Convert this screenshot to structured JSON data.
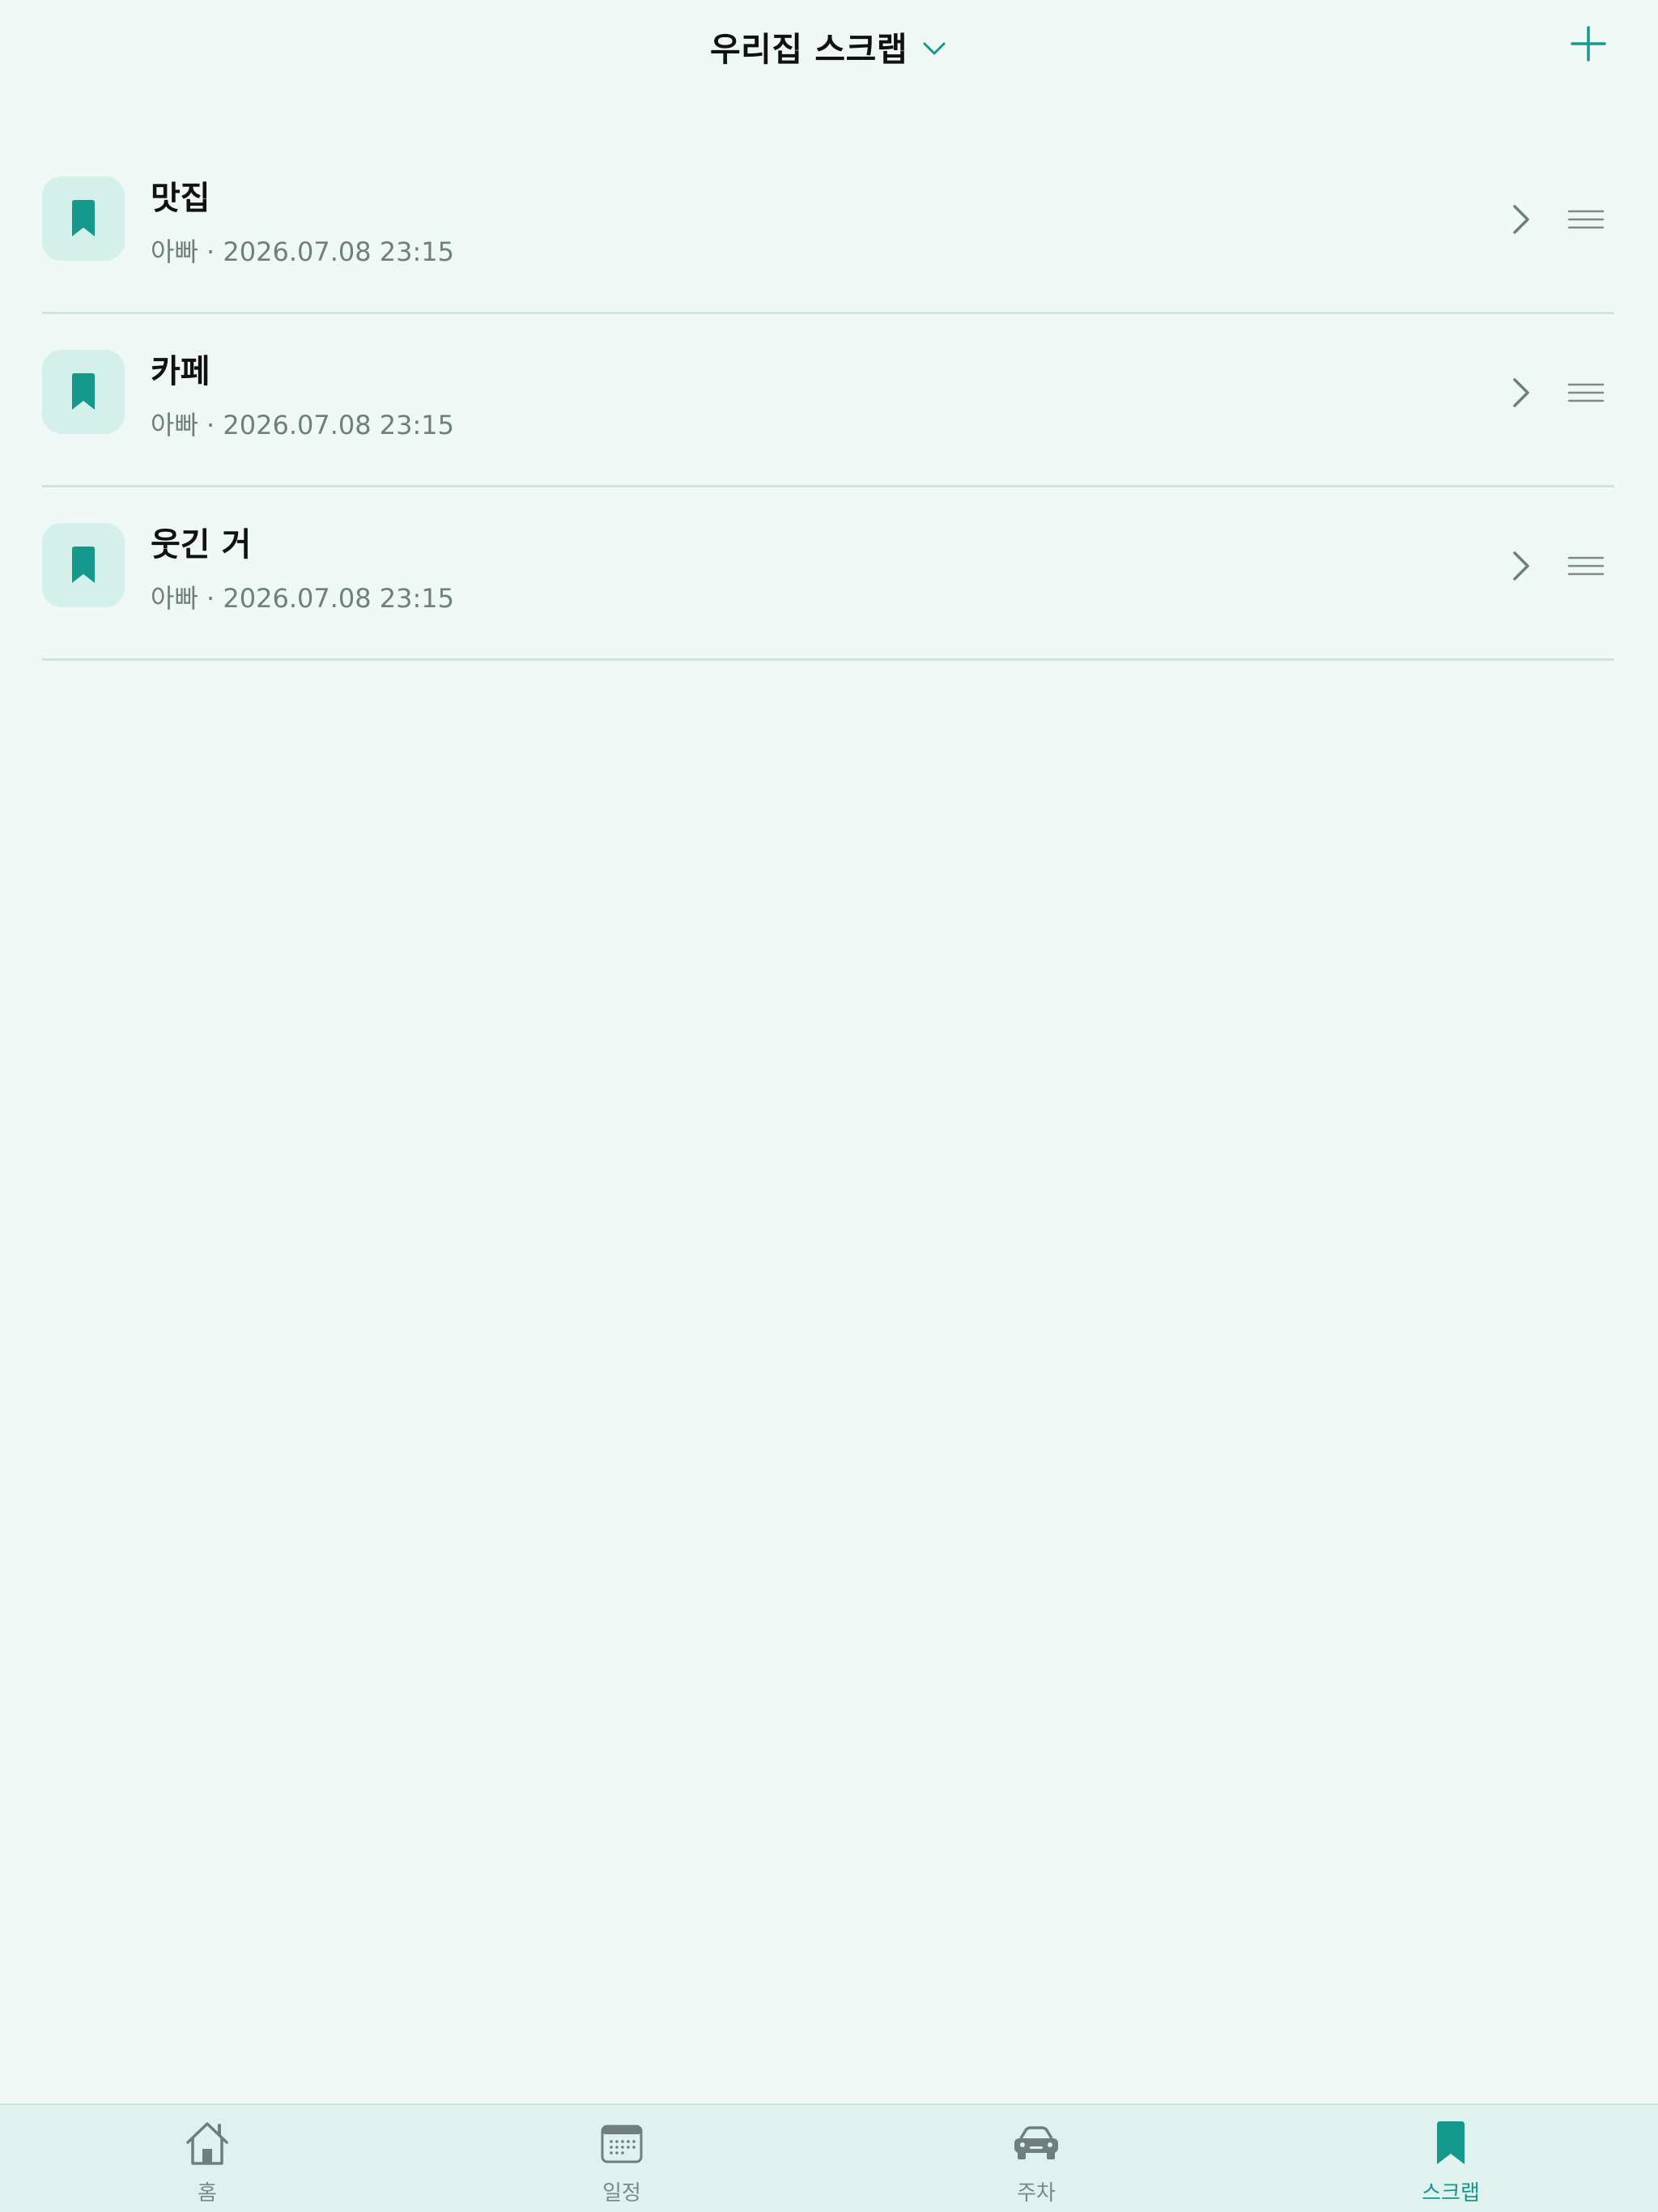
{
  "header": {
    "title": "우리집 스크랩",
    "title_dropdown_icon": "chevron-down-icon",
    "add_icon": "plus-icon"
  },
  "colors": {
    "accent": "#14998c",
    "background": "#eff8f5",
    "icon_tile": "#d4f0eb",
    "muted_text": "#6f7f7b",
    "divider": "#cfe6e0"
  },
  "scraps": [
    {
      "title": "맛집",
      "author": "아빠",
      "datetime": "2026.07.08 23:15",
      "meta": "아빠 · 2026.07.08 23:15",
      "icon": "bookmark-icon"
    },
    {
      "title": "카페",
      "author": "아빠",
      "datetime": "2026.07.08 23:15",
      "meta": "아빠 · 2026.07.08 23:15",
      "icon": "bookmark-icon"
    },
    {
      "title": "웃긴 거",
      "author": "아빠",
      "datetime": "2026.07.08 23:15",
      "meta": "아빠 · 2026.07.08 23:15",
      "icon": "bookmark-icon"
    }
  ],
  "tabbar": {
    "tabs": [
      {
        "label": "홈",
        "icon": "home-icon",
        "active": false
      },
      {
        "label": "일정",
        "icon": "calendar-icon",
        "active": false
      },
      {
        "label": "주차",
        "icon": "car-icon",
        "active": false
      },
      {
        "label": "스크랩",
        "icon": "bookmark-icon",
        "active": true
      }
    ]
  }
}
